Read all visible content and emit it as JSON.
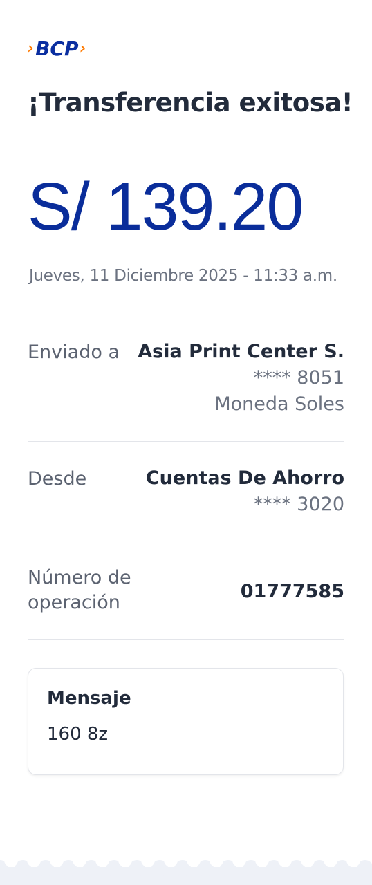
{
  "brand": {
    "name": "BCP",
    "chevron_left": "›",
    "chevron_right": "›",
    "accent_color": "#ff7a00",
    "brand_color": "#0a2ea0"
  },
  "title": "¡Transferencia exitosa!",
  "amount": "S/ 139.20",
  "datetime": "Jueves, 11 Diciembre 2025 - 11:33 a.m.",
  "sent_to": {
    "label": "Enviado a",
    "name": "Asia Print Center S.",
    "account": "**** 8051",
    "currency": "Moneda Soles"
  },
  "from": {
    "label": "Desde",
    "account_name": "Cuentas De Ahorro",
    "account": "**** 3020"
  },
  "operation": {
    "label_line1": "Número de",
    "label_line2": "operación",
    "number": "01777585"
  },
  "message": {
    "title": "Mensaje",
    "text": "160 8z"
  }
}
